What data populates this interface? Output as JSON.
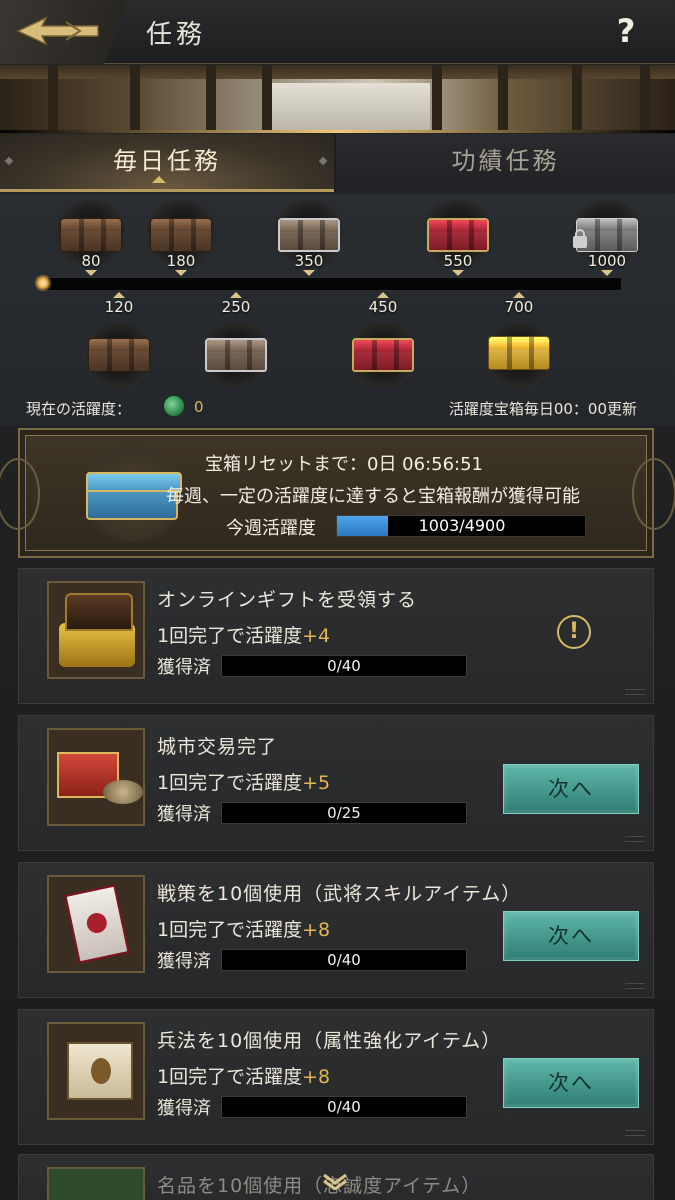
{
  "header": {
    "title": "任務",
    "help_label": "?"
  },
  "tabs": [
    {
      "label": "毎日任務",
      "selected": true
    },
    {
      "label": "功績任務",
      "selected": false
    }
  ],
  "activity": {
    "top_chests": [
      {
        "value": "80",
        "type": "wood"
      },
      {
        "value": "180",
        "type": "wood"
      },
      {
        "value": "350",
        "type": "silver"
      },
      {
        "value": "550",
        "type": "red"
      },
      {
        "value": "1000",
        "type": "gray",
        "locked": true
      }
    ],
    "bottom_chests": [
      {
        "value": "120",
        "type": "wood"
      },
      {
        "value": "250",
        "type": "silver"
      },
      {
        "value": "450",
        "type": "red"
      },
      {
        "value": "700",
        "type": "gold"
      }
    ],
    "progress": 0,
    "current_label": "現在の活躍度：",
    "current_value": "0",
    "reset_note": "活躍度宝箱毎日00：00更新"
  },
  "weekly": {
    "reset_text": "宝箱リセットまで：0日  06:56:51",
    "desc": "毎週、一定の活躍度に達すると宝箱報酬が獲得可能",
    "progress_label": "今週活躍度",
    "progress_text": "1003/4900",
    "progress_fraction": 0.2047
  },
  "tasks": [
    {
      "name": "オンラインギフトを受領する",
      "reward_prefix": "1回完了で活躍度",
      "reward_plus": "+4",
      "got_label": "獲得済",
      "progress": "0/40",
      "action": "alert"
    },
    {
      "name": "城市交易完了",
      "reward_prefix": "1回完了で活躍度",
      "reward_plus": "+5",
      "got_label": "獲得済",
      "progress": "0/25",
      "action": "次へ"
    },
    {
      "name": "戦策を10個使用（武将スキルアイテム）",
      "reward_prefix": "1回完了で活躍度",
      "reward_plus": "+8",
      "got_label": "獲得済",
      "progress": "0/40",
      "action": "次へ"
    },
    {
      "name": "兵法を10個使用（属性強化アイテム）",
      "reward_prefix": "1回完了で活躍度",
      "reward_plus": "+8",
      "got_label": "獲得済",
      "progress": "0/40",
      "action": "次へ"
    }
  ],
  "peek_task": {
    "name": "名品を10個使用（忠誠度アイテム）"
  },
  "colors": {
    "accent_gold": "#d9b866",
    "reward_plus": "#e2b754",
    "next_button": "#4f9e93",
    "weekly_bar": "#3a8ed8"
  }
}
